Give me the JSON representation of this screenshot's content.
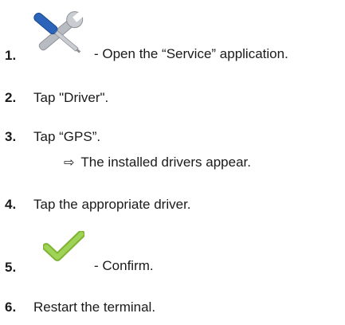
{
  "steps": [
    {
      "number": "1.",
      "text": "- Open the “Service” application.",
      "icon": "wrench-screwdriver-icon"
    },
    {
      "number": "2.",
      "text": "Tap \"Driver\"."
    },
    {
      "number": "3.",
      "text": "Tap “GPS”.",
      "result": "The installed drivers appear."
    },
    {
      "number": "4.",
      "text": "Tap the appropriate driver."
    },
    {
      "number": "5.",
      "text": "- Confirm.",
      "icon": "checkmark-icon"
    },
    {
      "number": "6.",
      "text": "Restart the terminal."
    }
  ],
  "result_arrow": "⇨",
  "colors": {
    "text": "#1a1a1a",
    "checkmark": "#8cc63f",
    "tool_blue": "#2b64b8",
    "tool_gray": "#b8bcc2"
  }
}
